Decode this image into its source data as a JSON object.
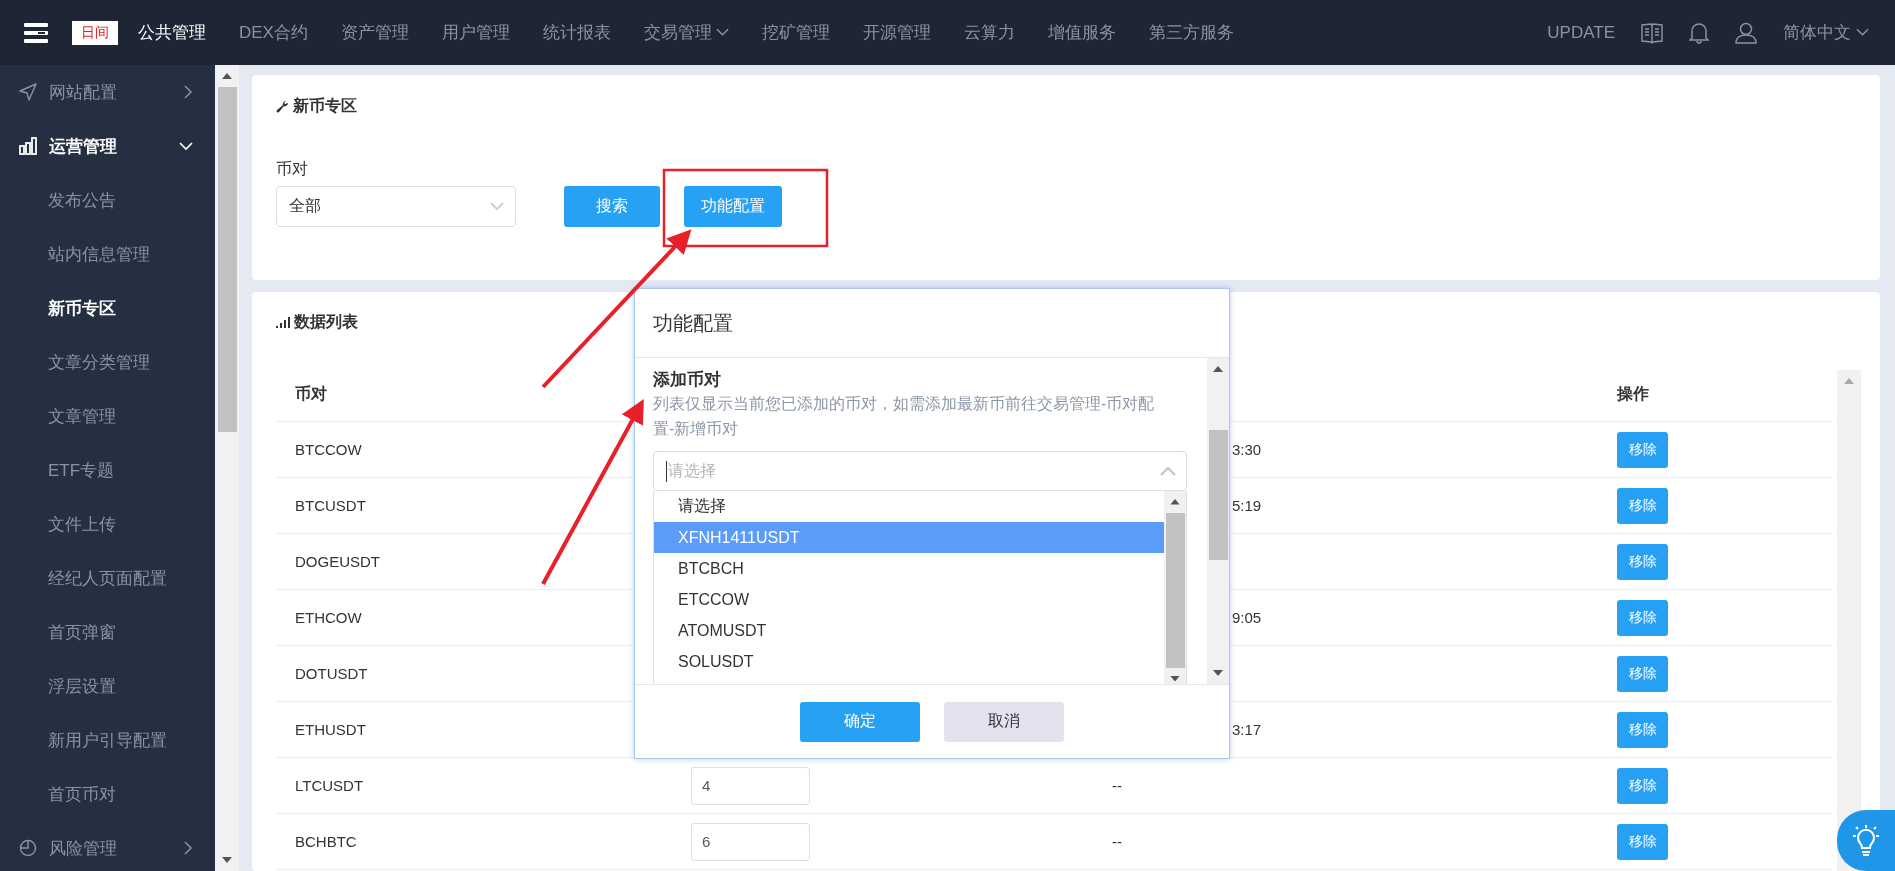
{
  "top_bar": {
    "badge": "日间",
    "nav": [
      {
        "label": "公共管理",
        "selected": true,
        "dropdown": false
      },
      {
        "label": "DEX合约",
        "selected": false,
        "dropdown": false
      },
      {
        "label": "资产管理",
        "selected": false,
        "dropdown": false
      },
      {
        "label": "用户管理",
        "selected": false,
        "dropdown": false
      },
      {
        "label": "统计报表",
        "selected": false,
        "dropdown": false
      },
      {
        "label": "交易管理",
        "selected": false,
        "dropdown": true
      },
      {
        "label": "挖矿管理",
        "selected": false,
        "dropdown": false
      },
      {
        "label": "开源管理",
        "selected": false,
        "dropdown": false
      },
      {
        "label": "云算力",
        "selected": false,
        "dropdown": false
      },
      {
        "label": "增值服务",
        "selected": false,
        "dropdown": false
      },
      {
        "label": "第三方服务",
        "selected": false,
        "dropdown": false
      }
    ],
    "update": "UPDATE",
    "language": "简体中文"
  },
  "sidebar": {
    "items": [
      {
        "label": "网站配置",
        "expanded": false
      },
      {
        "label": "运营管理",
        "expanded": true,
        "children": [
          {
            "label": "发布公告",
            "selected": false
          },
          {
            "label": "站内信息管理",
            "selected": false
          },
          {
            "label": "新币专区",
            "selected": true
          },
          {
            "label": "文章分类管理",
            "selected": false
          },
          {
            "label": "文章管理",
            "selected": false
          },
          {
            "label": "ETF专题",
            "selected": false
          },
          {
            "label": "文件上传",
            "selected": false
          },
          {
            "label": "经纪人页面配置",
            "selected": false
          },
          {
            "label": "首页弹窗",
            "selected": false
          },
          {
            "label": "浮层设置",
            "selected": false
          },
          {
            "label": "新用户引导配置",
            "selected": false
          },
          {
            "label": "首页币对",
            "selected": false
          }
        ]
      },
      {
        "label": "风险管理",
        "expanded": false
      }
    ]
  },
  "filter_card": {
    "title": "新币专区",
    "field_label": "币对",
    "select_value": "全部",
    "buttons": [
      "搜索",
      "功能配置"
    ]
  },
  "data_card": {
    "title": "数据列表",
    "columns": {
      "column_1": "币对",
      "column_4": "操作"
    },
    "rows": [
      {
        "column_1": "BTCCOW",
        "column_3": "3:30",
        "column_4": "移除"
      },
      {
        "column_1": "BTCUSDT",
        "column_3": "5:19",
        "column_4": "移除"
      },
      {
        "column_1": "DOGEUSDT",
        "column_4": "移除"
      },
      {
        "column_1": "ETHCOW",
        "column_3": "9:05",
        "column_4": "移除"
      },
      {
        "column_1": "DOTUSDT",
        "column_4": "移除"
      },
      {
        "column_1": "ETHUSDT",
        "column_3": "3:17",
        "column_4": "移除"
      },
      {
        "column_1": "LTCUSDT",
        "column_2": "4",
        "column_3": "--",
        "column_4": "移除"
      },
      {
        "column_1": "BCHBTC",
        "column_2": "6",
        "column_3": "--",
        "column_4": "移除"
      }
    ]
  },
  "dialog": {
    "title": "功能配置",
    "section_title": "添加币对",
    "hint": "列表仅显示当前您已添加的币对，如需添加最新币前往交易管理-币对配置-新增币对",
    "select": {
      "placeholder": "请选择",
      "expanded": true
    },
    "options": [
      {
        "label": "请选择",
        "selected": false
      },
      {
        "label": "XFNH1411USDT",
        "selected": true
      },
      {
        "label": "BTCBCH",
        "selected": false
      },
      {
        "label": "ETCCOW",
        "selected": false
      },
      {
        "label": "ATOMUSDT",
        "selected": false
      },
      {
        "label": "SOLUSDT",
        "selected": false
      }
    ],
    "buttons": [
      {
        "label": "确定",
        "kind": "primary"
      },
      {
        "label": "取消",
        "kind": "secondary"
      }
    ]
  }
}
